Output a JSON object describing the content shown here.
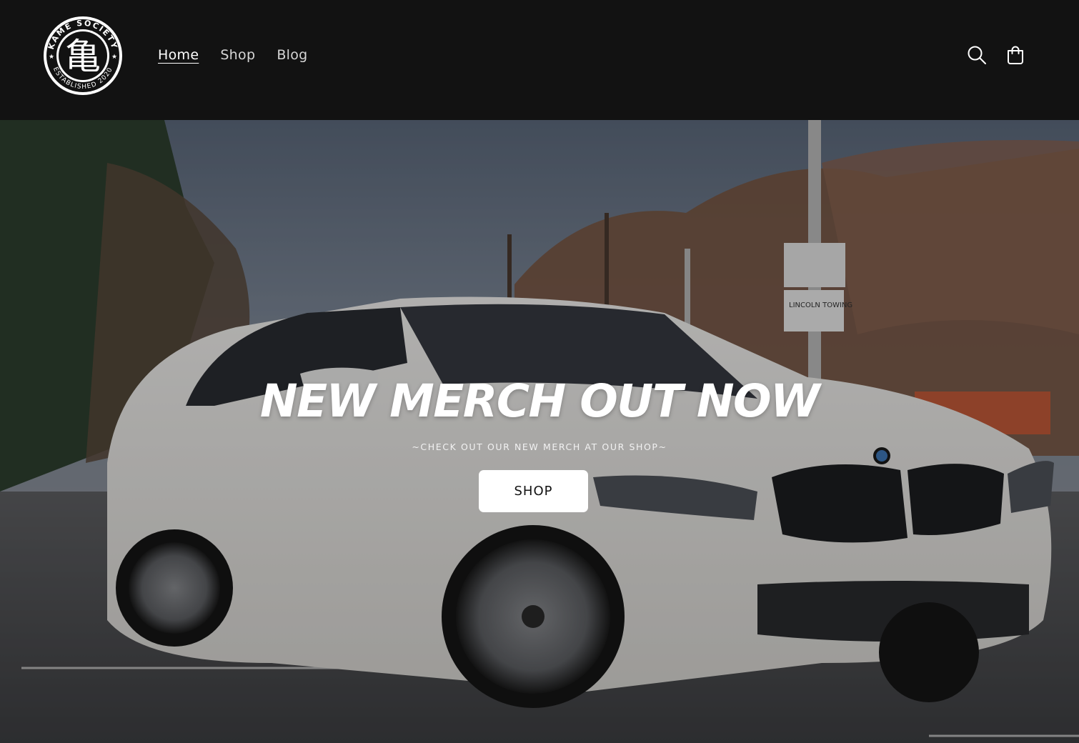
{
  "header": {
    "logo": {
      "icon": "kame-society-seal",
      "ring_text_top": "KAME SOCIETY",
      "ring_text_bottom": "ESTABLISHED 2020",
      "kanji": "亀"
    },
    "nav": [
      {
        "label": "Home",
        "active": true
      },
      {
        "label": "Shop",
        "active": false
      },
      {
        "label": "Blog",
        "active": false
      }
    ],
    "search_icon": "search-icon",
    "cart_icon": "cart-icon"
  },
  "hero": {
    "title": "NEW MERCH OUT NOW",
    "subtitle": "~CHECK OUT OUR NEW MERCH AT OUR SHOP~",
    "button_label": "SHOP",
    "background": "white sedan parked in a lot with trees",
    "sign_text": "LINCOLN TOWING"
  },
  "colors": {
    "header_bg": "#121212",
    "text_primary": "#ffffff",
    "button_bg": "#ffffff",
    "button_text": "#121212"
  }
}
